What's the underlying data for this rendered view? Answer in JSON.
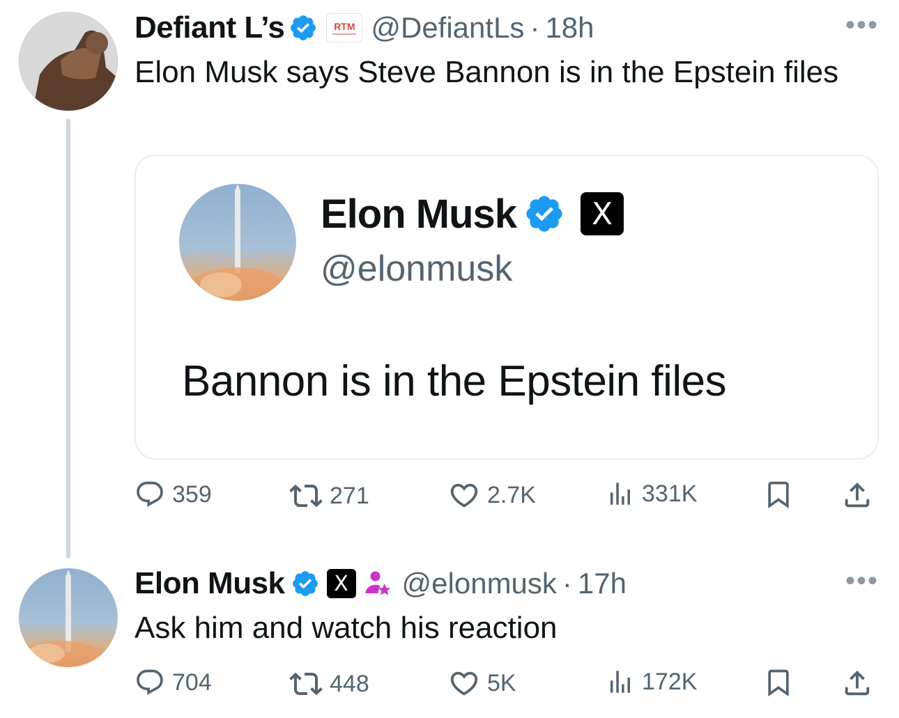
{
  "tweet1": {
    "author_name": "Defiant L’s",
    "org_badge_text": "RTM",
    "handle": "@DefiantLs",
    "time": "18h",
    "text": "Elon Musk says Steve Bannon is in the Epstein files",
    "quoted": {
      "author_name": "Elon Musk",
      "org_badge_glyph": "X",
      "handle": "@elonmusk",
      "text": "Bannon is in the Epstein files"
    },
    "stats": {
      "replies": "359",
      "reposts": "271",
      "likes": "2.7K",
      "views": "331K"
    }
  },
  "tweet2": {
    "author_name": "Elon Musk",
    "org_badge_glyph": "X",
    "handle": "@elonmusk",
    "time": "17h",
    "text": "Ask him and watch his reaction",
    "stats": {
      "replies": "704",
      "reposts": "448",
      "likes": "5K",
      "views": "172K"
    }
  },
  "colors": {
    "verified": "#1d9bf0",
    "muted": "#536471",
    "text": "#0f1419",
    "badge_pink": "#c935c9"
  },
  "icons": [
    "verified-badge-icon",
    "reply-icon",
    "repost-icon",
    "like-icon",
    "views-icon",
    "bookmark-icon",
    "share-icon",
    "more-icon"
  ]
}
